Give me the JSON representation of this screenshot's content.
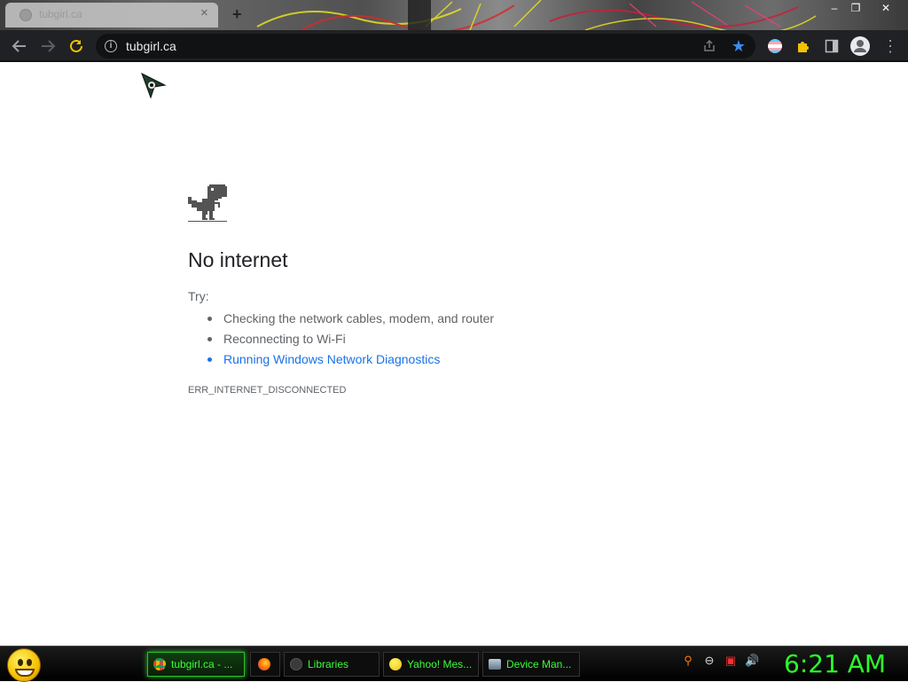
{
  "browser": {
    "tab_title": "tubgirl.ca",
    "new_tab_glyph": "+",
    "window_controls": {
      "minimize": "–",
      "restore": "❐",
      "close": "✕"
    },
    "toolbar": {
      "back_icon": "back-arrow-icon",
      "forward_icon": "forward-arrow-icon",
      "reload_icon": "reload-icon",
      "url": "tubgirl.ca",
      "bookmark_starred": true,
      "accent_star_color": "#3b8cf5"
    }
  },
  "page": {
    "heading": "No internet",
    "try_label": "Try:",
    "suggestions": [
      {
        "text": "Checking the network cables, modem, and router",
        "is_link": false
      },
      {
        "text": "Reconnecting to Wi-Fi",
        "is_link": false
      },
      {
        "text": "Running Windows Network Diagnostics",
        "is_link": true
      }
    ],
    "error_code": "ERR_INTERNET_DISCONNECTED",
    "link_color": "#1a73e8"
  },
  "taskbar": {
    "tasks": [
      {
        "label": "tubgirl.ca - ...",
        "icon": "chrome-icon",
        "active": true
      },
      {
        "label": "",
        "icon": "firefox-icon",
        "active": false
      },
      {
        "label": "Libraries",
        "icon": "folder-icon",
        "active": false
      },
      {
        "label": "Yahoo! Mes...",
        "icon": "yahoo-messenger-icon",
        "active": false
      },
      {
        "label": "Device Man...",
        "icon": "device-manager-icon",
        "active": false
      }
    ],
    "clock": "6:21 AM",
    "clock_color": "#2bff2b"
  }
}
